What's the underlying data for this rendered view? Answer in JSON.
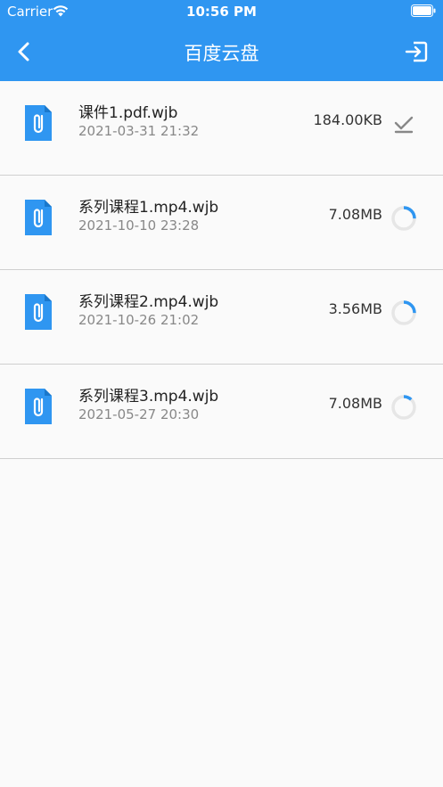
{
  "status_bar": {
    "carrier": "Carrier",
    "time": "10:56 PM"
  },
  "navbar": {
    "title": "百度云盘",
    "back_icon": "chevron-left-icon",
    "right_icon": "exit-icon"
  },
  "colors": {
    "primary": "#2f96f1",
    "file_icon": "#2f96f1",
    "check": "#888888",
    "progress": "#2f96f1",
    "progress_track": "#e6e6e6"
  },
  "files": [
    {
      "name": "课件1.pdf.wjb",
      "date": "2021-03-31 21:32",
      "size": "184.00KB",
      "status": "downloaded",
      "status_icon": "checkmark-icon"
    },
    {
      "name": "系列课程1.mp4.wjb",
      "date": "2021-10-10 23:28",
      "size": "7.08MB",
      "status": "downloading",
      "status_icon": "progress-spinner-icon",
      "progress": 0.25
    },
    {
      "name": "系列课程2.mp4.wjb",
      "date": "2021-10-26 21:02",
      "size": "3.56MB",
      "status": "downloading",
      "status_icon": "progress-spinner-icon",
      "progress": 0.25
    },
    {
      "name": "系列课程3.mp4.wjb",
      "date": "2021-05-27 20:30",
      "size": "7.08MB",
      "status": "downloading",
      "status_icon": "progress-spinner-icon",
      "progress": 0.12
    }
  ]
}
